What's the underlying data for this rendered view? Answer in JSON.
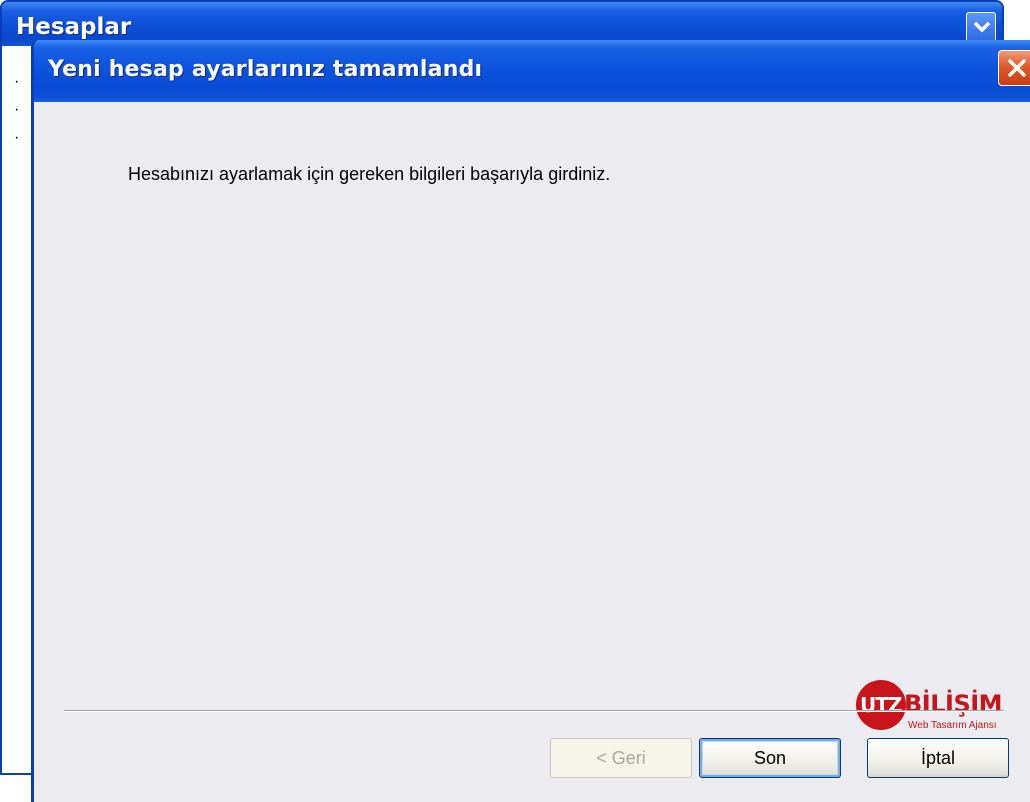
{
  "background_window": {
    "title": "Hesaplar"
  },
  "dialog": {
    "title": "Yeni hesap ayarlarınız tamamlandı",
    "message": "Hesabınızı ayarlamak için gereken bilgileri başarıyla girdiniz."
  },
  "logo": {
    "mark": "UTZ",
    "word": "BİLİŞİM",
    "tagline": "Web Tasarım Ajansı"
  },
  "buttons": {
    "back_label": "< Geri",
    "finish_label": "Son",
    "cancel_label": "İptal"
  },
  "colors": {
    "titlebar_blue": "#0a4cd5",
    "close_red": "#e05a2a",
    "logo_red": "#c8141a",
    "dialog_bg": "#ecebf0"
  }
}
